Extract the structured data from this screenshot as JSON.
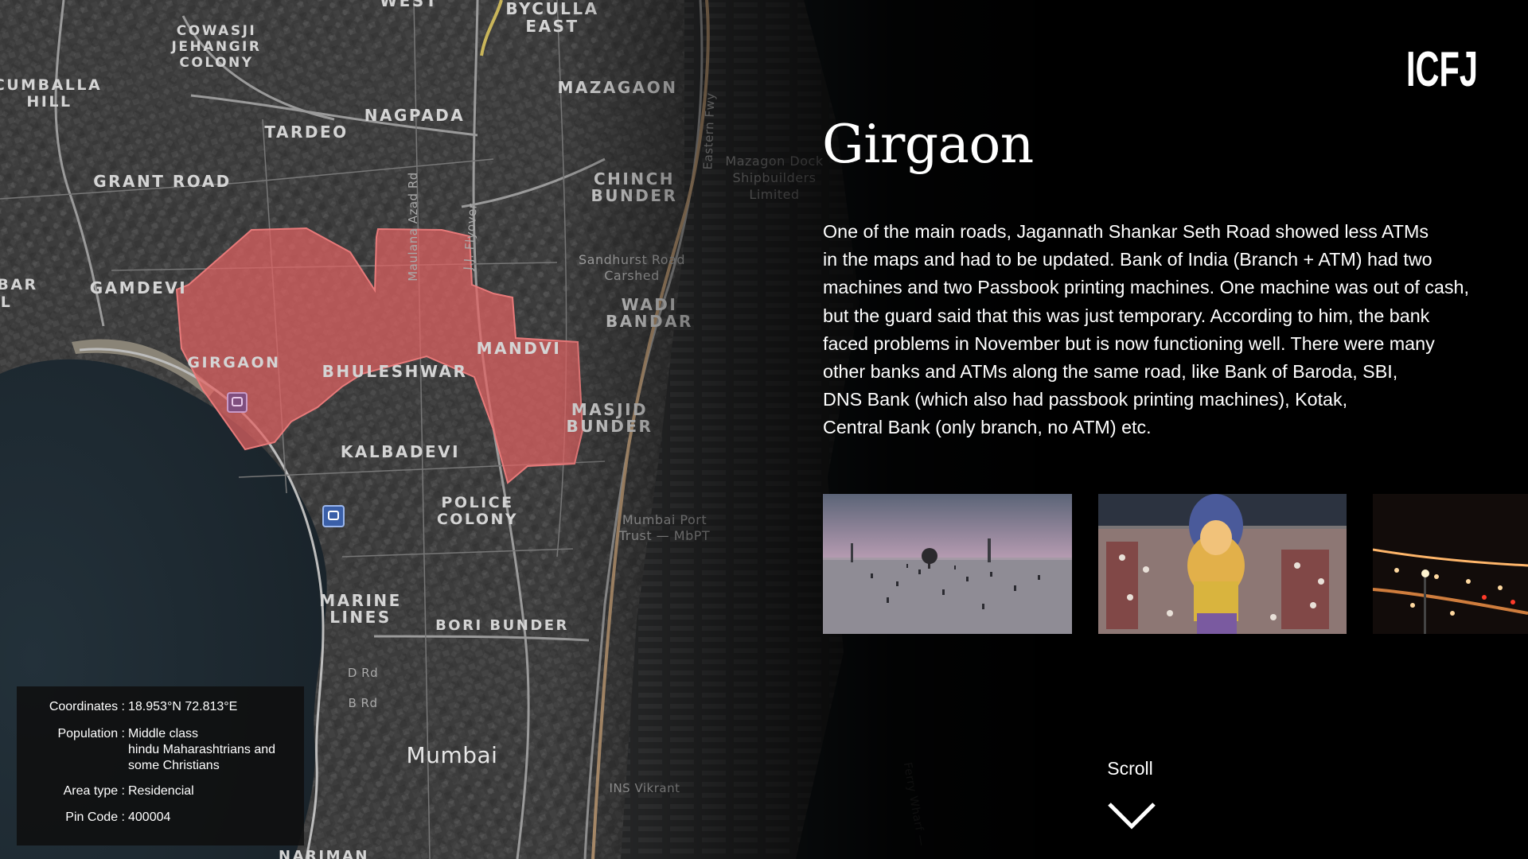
{
  "brand": {
    "logo_text": "ICFJ"
  },
  "map": {
    "labels": {
      "west": "WEST",
      "byculla_east": [
        "BYCULLA",
        "EAST"
      ],
      "cowasji": [
        "COWASJI",
        "JEHANGIR",
        "COLONY"
      ],
      "cumballa": [
        "CUMBALLA",
        "HILL"
      ],
      "mazagaon": "MAZAGAON",
      "nagpada": "NAGPADA",
      "tardeo": "TARDEO",
      "grant_road": "GRANT ROAD",
      "chinch_bunder": [
        "CHINCH",
        "BUNDER"
      ],
      "gamdevi": "GAMDEVI",
      "bar": [
        "BAR",
        "L"
      ],
      "wadi_bandar": [
        "WADI",
        "BANDAR"
      ],
      "girgaon": "GIRGAON",
      "bhuleshwar": "BHULESHWAR",
      "mandvi": "MANDVI",
      "masjid_bunder": [
        "MASJID",
        "BUNDER"
      ],
      "kalbadevi": "KALBADEVI",
      "police_colony": [
        "POLICE",
        "COLONY"
      ],
      "marine_lines": [
        "MARINE",
        "LINES"
      ],
      "bori_bunder": "BORI BUNDER",
      "mumbai": "Mumbai",
      "nariman": "NARIMAN",
      "eastern_fwy": "Eastern Fwy",
      "maulana_azad": "Maulana Azad Rd",
      "jj_flyover": "J.J. Flyover",
      "mazagon_dock": [
        "Mazagon Dock",
        "Shipbuilders",
        "Limited"
      ],
      "sandhurst": [
        "Sandhurst Road",
        "Carshed"
      ],
      "mumbai_port": [
        "Mumbai Port",
        "Trust — MbPT"
      ],
      "ins_vikrant": "INS Vikrant",
      "d_rd": "D Rd",
      "b_rd": "B Rd",
      "ferry_wharf": "Ferry Wharf —"
    }
  },
  "info": {
    "coordinates_label": "Coordinates :",
    "coordinates_value": "18.953°N 72.813°E",
    "population_label": "Population :",
    "population_value": "Middle class\nhindu Maharashtrians and\nsome Christians",
    "area_type_label": "Area type :",
    "area_type_value": "Residencial",
    "pin_code_label": "Pin Code :",
    "pin_code_value": "400004"
  },
  "article": {
    "title": "Girgaon",
    "description_lines": [
      "One of the main roads, Jagannath Shankar Seth Road showed less ATMs",
      "in the maps and had to be updated. Bank of India (Branch + ATM) had two",
      "machines and two Passbook printing machines. One machine was out of cash,",
      "but the guard said that this was just temporary. According to him, the bank",
      "faced problems in November but is now functioning well. There were many",
      "other banks and ATMs along the same road, like Bank of Baroda, SBI,",
      "DNS Bank (which also had passbook printing machines), Kotak,",
      "Central Bank (only branch, no ATM) etc."
    ]
  },
  "scroll": {
    "label": "Scroll",
    "icon": "chevron-down-icon"
  },
  "colors": {
    "highlight": "#e26262",
    "background": "#000000",
    "text": "#ffffff"
  }
}
